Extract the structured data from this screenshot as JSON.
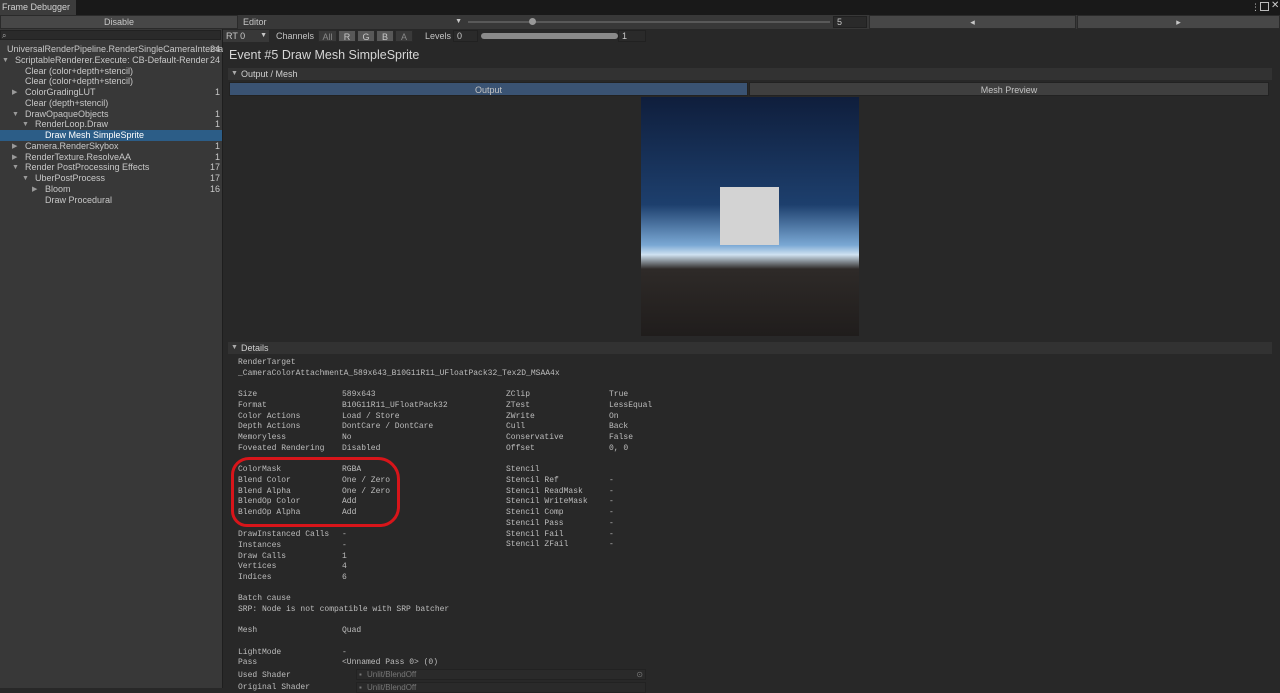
{
  "window": {
    "title": "Frame Debugger"
  },
  "toolbar": {
    "disable_label": "Disable",
    "target_label": "Editor",
    "event_value": "5",
    "prev_label": "◂",
    "next_label": "▸"
  },
  "rt_bar": {
    "rt_label": "RT 0",
    "channels_label": "Channels",
    "channel_buttons": [
      "All",
      "R",
      "G",
      "B",
      "A"
    ],
    "levels_label": "Levels",
    "levels_min": "0",
    "levels_max": "1"
  },
  "tree": [
    {
      "label": "UniversalRenderPipeline.RenderSingleCameraInternal",
      "count": "24",
      "arrow": "▼"
    },
    {
      "label": "ScriptableRenderer.Execute: CB-Default-Render",
      "count": "24",
      "arrow": "▼"
    },
    {
      "label": "Clear (color+depth+stencil)",
      "count": "",
      "arrow": ""
    },
    {
      "label": "Clear (color+depth+stencil)",
      "count": "",
      "arrow": ""
    },
    {
      "label": "ColorGradingLUT",
      "count": "1",
      "arrow": "▶"
    },
    {
      "label": "Clear (depth+stencil)",
      "count": "",
      "arrow": ""
    },
    {
      "label": "DrawOpaqueObjects",
      "count": "1",
      "arrow": "▼"
    },
    {
      "label": "RenderLoop.Draw",
      "count": "1",
      "arrow": "▼"
    },
    {
      "label": "Draw Mesh SimpleSprite",
      "count": "",
      "arrow": ""
    },
    {
      "label": "Camera.RenderSkybox",
      "count": "1",
      "arrow": "▶"
    },
    {
      "label": "RenderTexture.ResolveAA",
      "count": "1",
      "arrow": "▶"
    },
    {
      "label": "Render PostProcessing Effects",
      "count": "17",
      "arrow": "▼"
    },
    {
      "label": "UberPostProcess",
      "count": "17",
      "arrow": "▼"
    },
    {
      "label": "Bloom",
      "count": "16",
      "arrow": "▶"
    },
    {
      "label": "Draw Procedural",
      "count": "",
      "arrow": ""
    }
  ],
  "event_title": "Event #5 Draw Mesh SimpleSprite",
  "output_section": {
    "title": "Output / Mesh",
    "tab_output": "Output",
    "tab_mesh": "Mesh Preview"
  },
  "details": {
    "title": "Details",
    "render_target_label": "RenderTarget",
    "render_target_value": "_CameraColorAttachmentA_589x643_B10G11R11_UFloatPack32_Tex2D_MSAA4x",
    "left1": [
      [
        "Size",
        "589x643"
      ],
      [
        "Format",
        "B10G11R11_UFloatPack32"
      ],
      [
        "Color Actions",
        "Load / Store"
      ],
      [
        "Depth Actions",
        "DontCare / DontCare"
      ],
      [
        "Memoryless",
        "No"
      ],
      [
        "Foveated Rendering",
        "Disabled"
      ]
    ],
    "left2": [
      [
        "ColorMask",
        "RGBA"
      ],
      [
        "Blend Color",
        "One / Zero"
      ],
      [
        "Blend Alpha",
        "One / Zero"
      ],
      [
        "BlendOp Color",
        "Add"
      ],
      [
        "BlendOp Alpha",
        "Add"
      ]
    ],
    "left3": [
      [
        "DrawInstanced Calls",
        "-"
      ],
      [
        "Instances",
        "-"
      ],
      [
        "Draw Calls",
        "1"
      ],
      [
        "Vertices",
        "4"
      ],
      [
        "Indices",
        "6"
      ]
    ],
    "right1": [
      [
        "ZClip",
        "True"
      ],
      [
        "ZTest",
        "LessEqual"
      ],
      [
        "ZWrite",
        "On"
      ],
      [
        "Cull",
        "Back"
      ],
      [
        "Conservative",
        "False"
      ],
      [
        "Offset",
        "0, 0"
      ]
    ],
    "right2": [
      [
        "Stencil",
        ""
      ],
      [
        "Stencil Ref",
        "-"
      ],
      [
        "Stencil ReadMask",
        "-"
      ],
      [
        "Stencil WriteMask",
        "-"
      ],
      [
        "Stencil Comp",
        "-"
      ],
      [
        "Stencil Pass",
        "-"
      ],
      [
        "Stencil Fail",
        "-"
      ],
      [
        "Stencil ZFail",
        "-"
      ]
    ],
    "batch_cause_label": "Batch cause",
    "batch_cause_value": "SRP: Node is not compatible with SRP batcher",
    "mesh_label": "Mesh",
    "mesh_value": "Quad",
    "lightmode_label": "LightMode",
    "lightmode_value": "-",
    "pass_label": "Pass",
    "pass_value": "<Unnamed Pass 0> (0)",
    "used_shader_label": "Used Shader",
    "used_shader_value": "Unlit/BlendOff",
    "original_shader_label": "Original Shader",
    "original_shader_value": "Unlit/BlendOff"
  },
  "colors": {
    "selection": "#2c5d87",
    "annotation": "#d8151a",
    "tab_active": "#3a5373"
  }
}
